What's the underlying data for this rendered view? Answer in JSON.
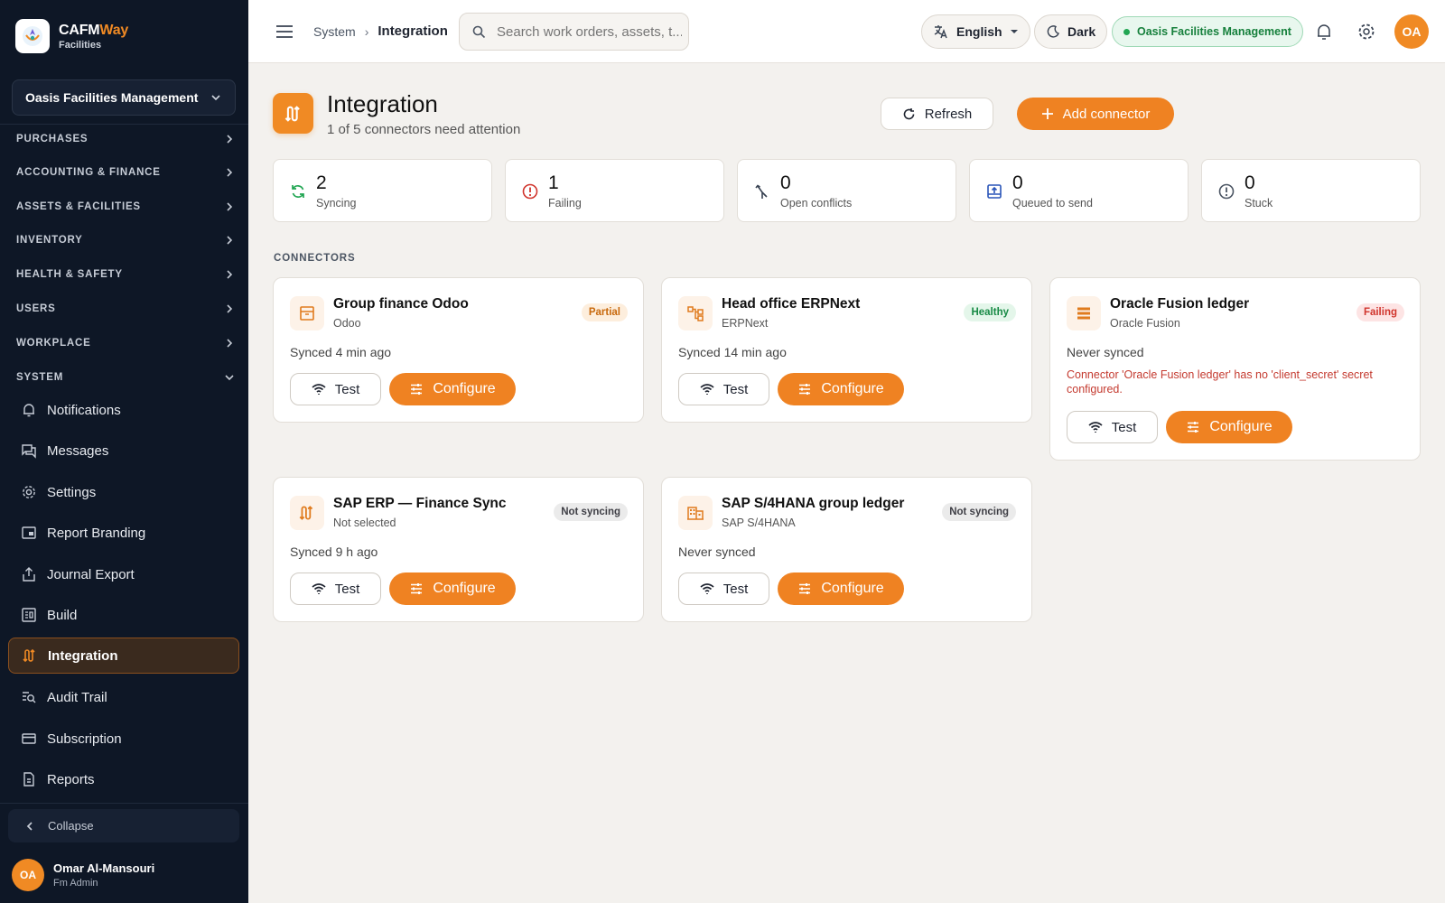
{
  "brand": {
    "name_main": "CAFM",
    "name_accent": "Way",
    "sub": "Facilities"
  },
  "sidebar": {
    "org": "Oasis Facilities Management",
    "sections": [
      {
        "label": "PURCHASES"
      },
      {
        "label": "ACCOUNTING & FINANCE"
      },
      {
        "label": "ASSETS & FACILITIES"
      },
      {
        "label": "INVENTORY"
      },
      {
        "label": "HEALTH & SAFETY"
      },
      {
        "label": "USERS"
      },
      {
        "label": "WORKPLACE"
      },
      {
        "label": "SYSTEM"
      }
    ],
    "items": [
      {
        "label": "Notifications",
        "icon": "bell-icon"
      },
      {
        "label": "Messages",
        "icon": "chat-icon"
      },
      {
        "label": "Settings",
        "icon": "gear-icon"
      },
      {
        "label": "Report Branding",
        "icon": "branding-icon"
      },
      {
        "label": "Journal Export",
        "icon": "export-icon"
      },
      {
        "label": "Build",
        "icon": "build-icon"
      },
      {
        "label": "Integration",
        "icon": "integration-icon",
        "active": true
      },
      {
        "label": "Audit Trail",
        "icon": "audit-icon"
      },
      {
        "label": "Subscription",
        "icon": "card-icon"
      },
      {
        "label": "Reports",
        "icon": "report-icon"
      }
    ],
    "collapse_label": "Collapse",
    "user": {
      "initials": "OA",
      "name": "Omar Al-Mansouri",
      "role": "Fm Admin"
    }
  },
  "topbar": {
    "breadcrumb": [
      "System",
      "Integration"
    ],
    "search_placeholder": "Search work orders, assets, t...",
    "language": "English",
    "theme": "Dark",
    "org_pill": "Oasis Facilities Management",
    "avatar_initials": "OA"
  },
  "page": {
    "title": "Integration",
    "subtitle": "1 of 5 connectors need attention",
    "refresh_label": "Refresh",
    "add_label": "Add connector",
    "section_label": "CONNECTORS"
  },
  "stats": [
    {
      "value": "2",
      "label": "Syncing",
      "icon": "sync-icon",
      "color": "#22a653"
    },
    {
      "value": "1",
      "label": "Failing",
      "icon": "alert-icon",
      "color": "#d0342c"
    },
    {
      "value": "0",
      "label": "Open conflicts",
      "icon": "merge-icon",
      "color": "#374151"
    },
    {
      "value": "0",
      "label": "Queued to send",
      "icon": "outbox-icon",
      "color": "#2a55b8"
    },
    {
      "value": "0",
      "label": "Stuck",
      "icon": "info-icon",
      "color": "#4b5563"
    }
  ],
  "connectors": [
    {
      "title": "Group finance Odoo",
      "sub": "Odoo",
      "badge": "Partial",
      "badge_type": "partial",
      "meta": "Synced 4 min ago",
      "error": "",
      "icon": "archive-icon"
    },
    {
      "title": "Head office ERPNext",
      "sub": "ERPNext",
      "badge": "Healthy",
      "badge_type": "healthy",
      "meta": "Synced 14 min ago",
      "error": "",
      "icon": "hierarchy-icon"
    },
    {
      "title": "Oracle Fusion ledger",
      "sub": "Oracle Fusion",
      "badge": "Failing",
      "badge_type": "failing",
      "meta": "Never synced",
      "error": "Connector 'Oracle Fusion ledger' has no 'client_secret' secret configured.",
      "icon": "list-icon"
    },
    {
      "title": "SAP ERP — Finance Sync",
      "sub": "Not selected",
      "badge": "Not syncing",
      "badge_type": "not",
      "meta": "Synced 9 h ago",
      "error": "",
      "icon": "integration-icon"
    },
    {
      "title": "SAP S/4HANA group ledger",
      "sub": "SAP S/4HANA",
      "badge": "Not syncing",
      "badge_type": "not",
      "meta": "Never synced",
      "error": "",
      "icon": "building-icon"
    }
  ],
  "buttons": {
    "test": "Test",
    "configure": "Configure"
  },
  "colors": {
    "accent": "#ef8222",
    "sidebar_bg": "#0e1726"
  }
}
